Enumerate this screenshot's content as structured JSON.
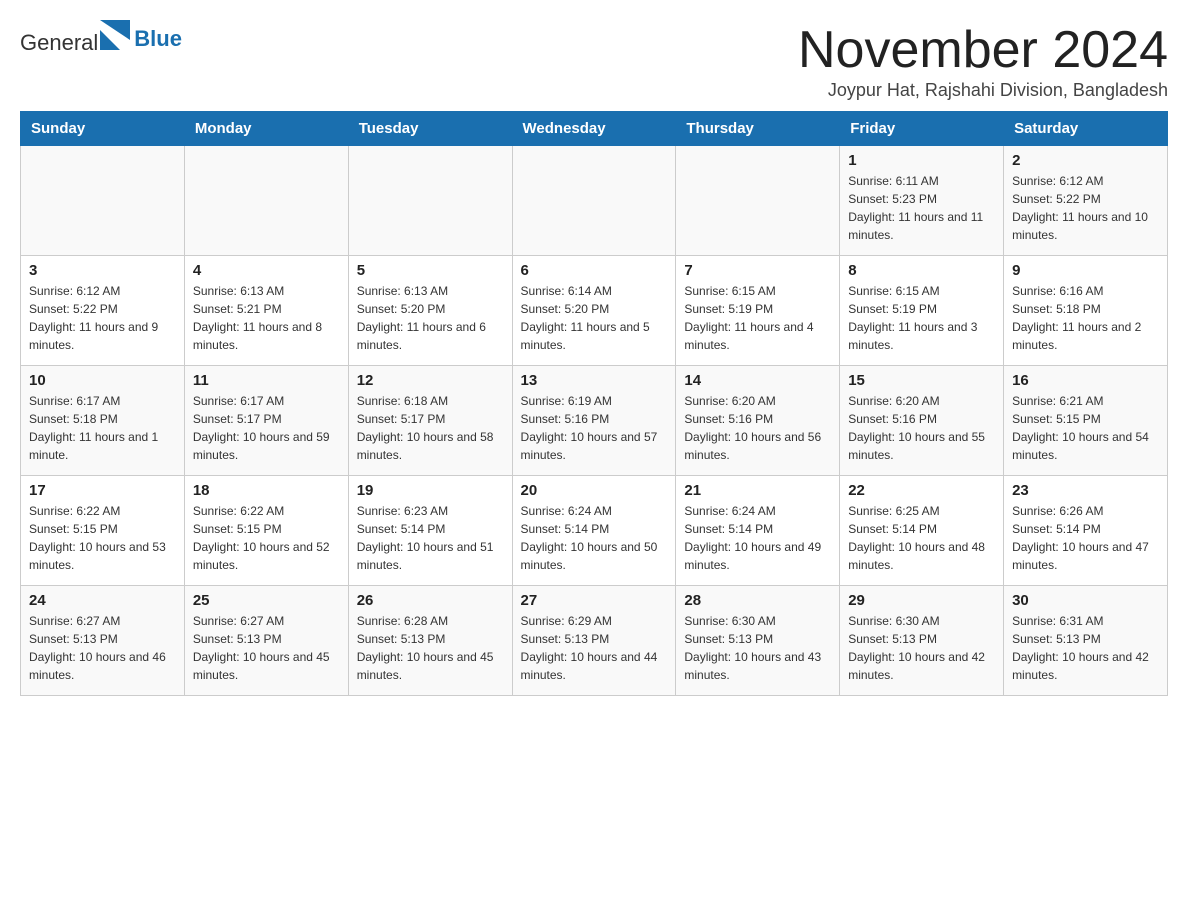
{
  "header": {
    "logo_general": "General",
    "logo_blue": "Blue",
    "month_title": "November 2024",
    "location": "Joypur Hat, Rajshahi Division, Bangladesh"
  },
  "days_of_week": [
    "Sunday",
    "Monday",
    "Tuesday",
    "Wednesday",
    "Thursday",
    "Friday",
    "Saturday"
  ],
  "weeks": [
    [
      {
        "day": "",
        "sunrise": "",
        "sunset": "",
        "daylight": ""
      },
      {
        "day": "",
        "sunrise": "",
        "sunset": "",
        "daylight": ""
      },
      {
        "day": "",
        "sunrise": "",
        "sunset": "",
        "daylight": ""
      },
      {
        "day": "",
        "sunrise": "",
        "sunset": "",
        "daylight": ""
      },
      {
        "day": "",
        "sunrise": "",
        "sunset": "",
        "daylight": ""
      },
      {
        "day": "1",
        "sunrise": "Sunrise: 6:11 AM",
        "sunset": "Sunset: 5:23 PM",
        "daylight": "Daylight: 11 hours and 11 minutes."
      },
      {
        "day": "2",
        "sunrise": "Sunrise: 6:12 AM",
        "sunset": "Sunset: 5:22 PM",
        "daylight": "Daylight: 11 hours and 10 minutes."
      }
    ],
    [
      {
        "day": "3",
        "sunrise": "Sunrise: 6:12 AM",
        "sunset": "Sunset: 5:22 PM",
        "daylight": "Daylight: 11 hours and 9 minutes."
      },
      {
        "day": "4",
        "sunrise": "Sunrise: 6:13 AM",
        "sunset": "Sunset: 5:21 PM",
        "daylight": "Daylight: 11 hours and 8 minutes."
      },
      {
        "day": "5",
        "sunrise": "Sunrise: 6:13 AM",
        "sunset": "Sunset: 5:20 PM",
        "daylight": "Daylight: 11 hours and 6 minutes."
      },
      {
        "day": "6",
        "sunrise": "Sunrise: 6:14 AM",
        "sunset": "Sunset: 5:20 PM",
        "daylight": "Daylight: 11 hours and 5 minutes."
      },
      {
        "day": "7",
        "sunrise": "Sunrise: 6:15 AM",
        "sunset": "Sunset: 5:19 PM",
        "daylight": "Daylight: 11 hours and 4 minutes."
      },
      {
        "day": "8",
        "sunrise": "Sunrise: 6:15 AM",
        "sunset": "Sunset: 5:19 PM",
        "daylight": "Daylight: 11 hours and 3 minutes."
      },
      {
        "day": "9",
        "sunrise": "Sunrise: 6:16 AM",
        "sunset": "Sunset: 5:18 PM",
        "daylight": "Daylight: 11 hours and 2 minutes."
      }
    ],
    [
      {
        "day": "10",
        "sunrise": "Sunrise: 6:17 AM",
        "sunset": "Sunset: 5:18 PM",
        "daylight": "Daylight: 11 hours and 1 minute."
      },
      {
        "day": "11",
        "sunrise": "Sunrise: 6:17 AM",
        "sunset": "Sunset: 5:17 PM",
        "daylight": "Daylight: 10 hours and 59 minutes."
      },
      {
        "day": "12",
        "sunrise": "Sunrise: 6:18 AM",
        "sunset": "Sunset: 5:17 PM",
        "daylight": "Daylight: 10 hours and 58 minutes."
      },
      {
        "day": "13",
        "sunrise": "Sunrise: 6:19 AM",
        "sunset": "Sunset: 5:16 PM",
        "daylight": "Daylight: 10 hours and 57 minutes."
      },
      {
        "day": "14",
        "sunrise": "Sunrise: 6:20 AM",
        "sunset": "Sunset: 5:16 PM",
        "daylight": "Daylight: 10 hours and 56 minutes."
      },
      {
        "day": "15",
        "sunrise": "Sunrise: 6:20 AM",
        "sunset": "Sunset: 5:16 PM",
        "daylight": "Daylight: 10 hours and 55 minutes."
      },
      {
        "day": "16",
        "sunrise": "Sunrise: 6:21 AM",
        "sunset": "Sunset: 5:15 PM",
        "daylight": "Daylight: 10 hours and 54 minutes."
      }
    ],
    [
      {
        "day": "17",
        "sunrise": "Sunrise: 6:22 AM",
        "sunset": "Sunset: 5:15 PM",
        "daylight": "Daylight: 10 hours and 53 minutes."
      },
      {
        "day": "18",
        "sunrise": "Sunrise: 6:22 AM",
        "sunset": "Sunset: 5:15 PM",
        "daylight": "Daylight: 10 hours and 52 minutes."
      },
      {
        "day": "19",
        "sunrise": "Sunrise: 6:23 AM",
        "sunset": "Sunset: 5:14 PM",
        "daylight": "Daylight: 10 hours and 51 minutes."
      },
      {
        "day": "20",
        "sunrise": "Sunrise: 6:24 AM",
        "sunset": "Sunset: 5:14 PM",
        "daylight": "Daylight: 10 hours and 50 minutes."
      },
      {
        "day": "21",
        "sunrise": "Sunrise: 6:24 AM",
        "sunset": "Sunset: 5:14 PM",
        "daylight": "Daylight: 10 hours and 49 minutes."
      },
      {
        "day": "22",
        "sunrise": "Sunrise: 6:25 AM",
        "sunset": "Sunset: 5:14 PM",
        "daylight": "Daylight: 10 hours and 48 minutes."
      },
      {
        "day": "23",
        "sunrise": "Sunrise: 6:26 AM",
        "sunset": "Sunset: 5:14 PM",
        "daylight": "Daylight: 10 hours and 47 minutes."
      }
    ],
    [
      {
        "day": "24",
        "sunrise": "Sunrise: 6:27 AM",
        "sunset": "Sunset: 5:13 PM",
        "daylight": "Daylight: 10 hours and 46 minutes."
      },
      {
        "day": "25",
        "sunrise": "Sunrise: 6:27 AM",
        "sunset": "Sunset: 5:13 PM",
        "daylight": "Daylight: 10 hours and 45 minutes."
      },
      {
        "day": "26",
        "sunrise": "Sunrise: 6:28 AM",
        "sunset": "Sunset: 5:13 PM",
        "daylight": "Daylight: 10 hours and 45 minutes."
      },
      {
        "day": "27",
        "sunrise": "Sunrise: 6:29 AM",
        "sunset": "Sunset: 5:13 PM",
        "daylight": "Daylight: 10 hours and 44 minutes."
      },
      {
        "day": "28",
        "sunrise": "Sunrise: 6:30 AM",
        "sunset": "Sunset: 5:13 PM",
        "daylight": "Daylight: 10 hours and 43 minutes."
      },
      {
        "day": "29",
        "sunrise": "Sunrise: 6:30 AM",
        "sunset": "Sunset: 5:13 PM",
        "daylight": "Daylight: 10 hours and 42 minutes."
      },
      {
        "day": "30",
        "sunrise": "Sunrise: 6:31 AM",
        "sunset": "Sunset: 5:13 PM",
        "daylight": "Daylight: 10 hours and 42 minutes."
      }
    ]
  ]
}
